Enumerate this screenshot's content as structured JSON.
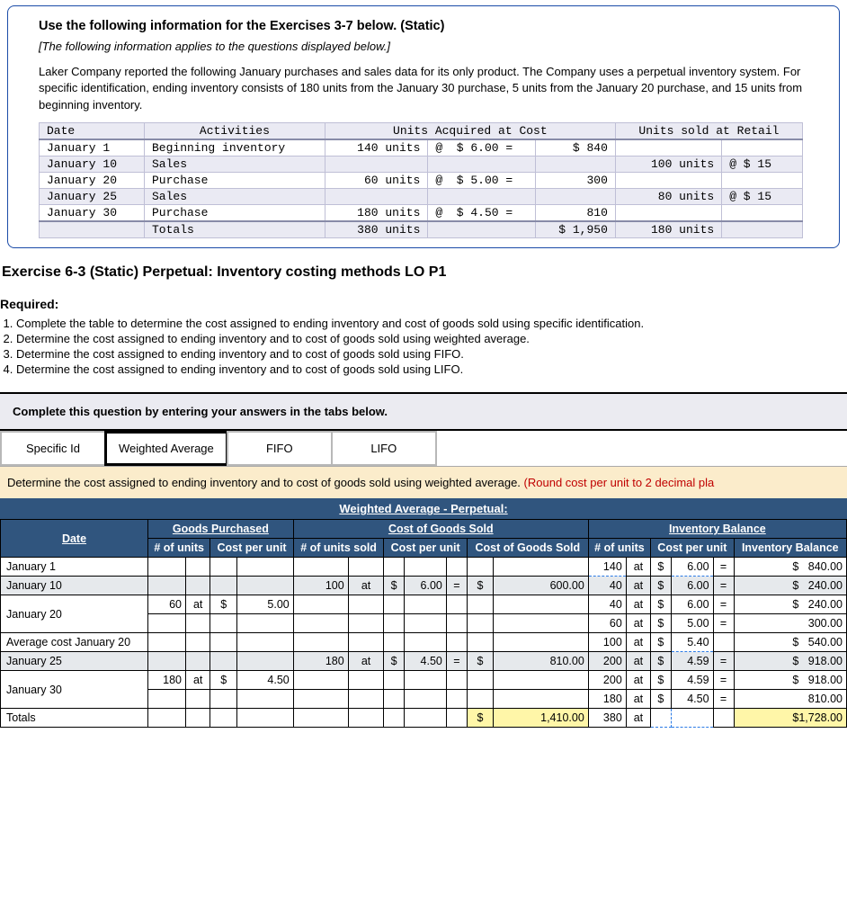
{
  "info": {
    "heading": "Use the following information for the Exercises 3-7 below. (Static)",
    "italic": "[The following information applies to the questions displayed below.]",
    "para": "Laker Company reported the following January purchases and sales data for its only product. The Company uses a perpetual inventory system. For specific identification, ending inventory consists of 180 units from the January 30 purchase, 5 units from the January 20 purchase, and 15 units from beginning inventory.",
    "hdr_date": "Date",
    "hdr_act": "Activities",
    "hdr_acq": "Units Acquired at Cost",
    "hdr_sold": "Units sold at Retail",
    "rows": [
      {
        "date": "January 1",
        "act": "Beginning inventory",
        "acq_u": "140 units",
        "acq_p": "@  $ 6.00 =",
        "acq_t": "$ 840",
        "sold_u": "",
        "sold_p": ""
      },
      {
        "date": "January 10",
        "act": "Sales",
        "acq_u": "",
        "acq_p": "",
        "acq_t": "",
        "sold_u": "100 units",
        "sold_p": "@ $ 15"
      },
      {
        "date": "January 20",
        "act": "Purchase",
        "acq_u": "60 units",
        "acq_p": "@  $ 5.00 =",
        "acq_t": "300",
        "sold_u": "",
        "sold_p": ""
      },
      {
        "date": "January 25",
        "act": "Sales",
        "acq_u": "",
        "acq_p": "",
        "acq_t": "",
        "sold_u": "80 units",
        "sold_p": "@ $ 15"
      },
      {
        "date": "January 30",
        "act": "Purchase",
        "acq_u": "180 units",
        "acq_p": "@  $ 4.50 =",
        "acq_t": "810",
        "sold_u": "",
        "sold_p": ""
      }
    ],
    "totals": {
      "act": "Totals",
      "acq_u": "380 units",
      "acq_t": "$ 1,950",
      "sold_u": "180 units"
    }
  },
  "exercise_title": "Exercise 6-3 (Static) Perpetual: Inventory costing methods LO P1",
  "required_label": "Required:",
  "required_items": [
    "Complete the table to determine the cost assigned to ending inventory and cost of goods sold using specific identification.",
    "Determine the cost assigned to ending inventory and to cost of goods sold using weighted average.",
    "Determine the cost assigned to ending inventory and to cost of goods sold using FIFO.",
    "Determine the cost assigned to ending inventory and to cost of goods sold using LIFO."
  ],
  "tab_instruction": "Complete this question by entering your answers in the tabs below.",
  "tabs": [
    "Specific Id",
    "Weighted Average",
    "FIFO",
    "LIFO"
  ],
  "tab_prompt_main": "Determine the cost assigned to ending inventory and to cost of goods sold using weighted average. ",
  "tab_prompt_red": "(Round cost per unit to 2 decimal pla",
  "wa_title": "Weighted Average - Perpetual:",
  "col_groups": {
    "date": "Date",
    "gp": "Goods Purchased",
    "cogs": "Cost of Goods Sold",
    "inv": "Inventory Balance"
  },
  "col_headers": {
    "gp_u": "# of units",
    "gp_c": "Cost per unit",
    "cogs_u": "# of units sold",
    "cogs_c": "Cost per unit",
    "cogs_t": "Cost of Goods Sold",
    "inv_u": "# of units",
    "inv_c": "Cost per unit",
    "inv_t": "Inventory Balance"
  },
  "ans": {
    "jan1": {
      "date": "January 1",
      "inv_u": "140",
      "at": "at",
      "inv_c_s": "$",
      "inv_c": "6.00",
      "eq": "=",
      "inv_t_s": "$",
      "inv_t": "840.00"
    },
    "jan10": {
      "date": "January 10",
      "cogs_u": "100",
      "at": "at",
      "cogs_c_s": "$",
      "cogs_c": "6.00",
      "eq": "=",
      "cogs_t_s": "$",
      "cogs_t": "600.00",
      "inv_u": "40",
      "inv_c_s": "$",
      "inv_c": "6.00",
      "inv_t_s": "$",
      "inv_t": "240.00"
    },
    "jan20a": {
      "date": "January 20",
      "gp_u": "60",
      "at": "at",
      "gp_c_s": "$",
      "gp_c": "5.00",
      "inv_u": "40",
      "inv_c_s": "$",
      "inv_c": "6.00",
      "eq": "=",
      "inv_t_s": "$",
      "inv_t": "240.00"
    },
    "jan20b": {
      "inv_u": "60",
      "at": "at",
      "inv_c_s": "$",
      "inv_c": "5.00",
      "eq": "=",
      "inv_t": "300.00"
    },
    "avg20": {
      "date": "Average cost January 20",
      "inv_u": "100",
      "at": "at",
      "inv_c_s": "$",
      "inv_c": "5.40",
      "inv_t_s": "$",
      "inv_t": "540.00"
    },
    "jan25": {
      "date": "January 25",
      "cogs_u": "180",
      "at": "at",
      "cogs_c_s": "$",
      "cogs_c": "4.50",
      "eq": "=",
      "cogs_t_s": "$",
      "cogs_t": "810.00",
      "inv_u": "200",
      "inv_c_s": "$",
      "inv_c": "4.59",
      "inv_t_s": "$",
      "inv_t": "918.00"
    },
    "jan30a": {
      "date": "January 30",
      "gp_u": "180",
      "at": "at",
      "gp_c_s": "$",
      "gp_c": "4.50",
      "inv_u": "200",
      "inv_c_s": "$",
      "inv_c": "4.59",
      "eq": "=",
      "inv_t_s": "$",
      "inv_t": "918.00"
    },
    "jan30b": {
      "inv_u": "180",
      "at": "at",
      "inv_c_s": "$",
      "inv_c": "4.50",
      "eq": "=",
      "inv_t": "810.00"
    },
    "totals": {
      "date": "Totals",
      "cogs_t_s": "$",
      "cogs_t": "1,410.00",
      "inv_u": "380",
      "at": "at",
      "inv_t": "$1,728.00"
    }
  }
}
